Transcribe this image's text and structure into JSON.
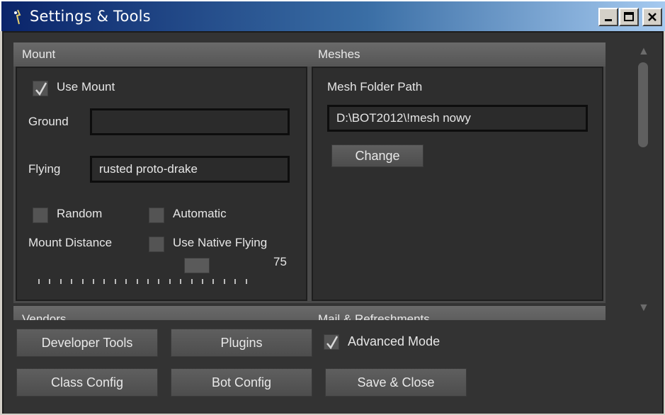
{
  "window": {
    "title": "Settings & Tools",
    "icon": "app-icon",
    "controls": [
      "minimize-icon",
      "maximize-icon",
      "close-icon"
    ]
  },
  "mount_panel": {
    "header": "Mount",
    "use_mount_label": "Use Mount",
    "use_mount_checked": true,
    "ground_label": "Ground",
    "ground_value": "",
    "flying_label": "Flying",
    "flying_value": "rusted proto-drake",
    "random_label": "Random",
    "random_checked": false,
    "automatic_label": "Automatic",
    "automatic_checked": false,
    "mount_distance_label": "Mount Distance",
    "use_native_flying_label": "Use Native Flying",
    "use_native_flying_checked": false,
    "distance_value": "75"
  },
  "meshes_panel": {
    "header": "Meshes",
    "mesh_folder_label": "Mesh Folder Path",
    "mesh_folder_value": "D:\\BOT2012\\!mesh nowy",
    "change_button": "Change"
  },
  "partial_panels": {
    "vendors_header": "Vendors",
    "mail_header": "Mail & Refreshments"
  },
  "bottom": {
    "developer_tools": "Developer Tools",
    "plugins": "Plugins",
    "advanced_mode_label": "Advanced Mode",
    "advanced_mode_checked": true,
    "class_config": "Class Config",
    "bot_config": "Bot Config",
    "save_close": "Save & Close"
  },
  "colors": {
    "titlebar_start": "#0a246a",
    "panel_background": "#2e2e2e",
    "client_background": "#333333",
    "text": "#e6e6e6"
  }
}
